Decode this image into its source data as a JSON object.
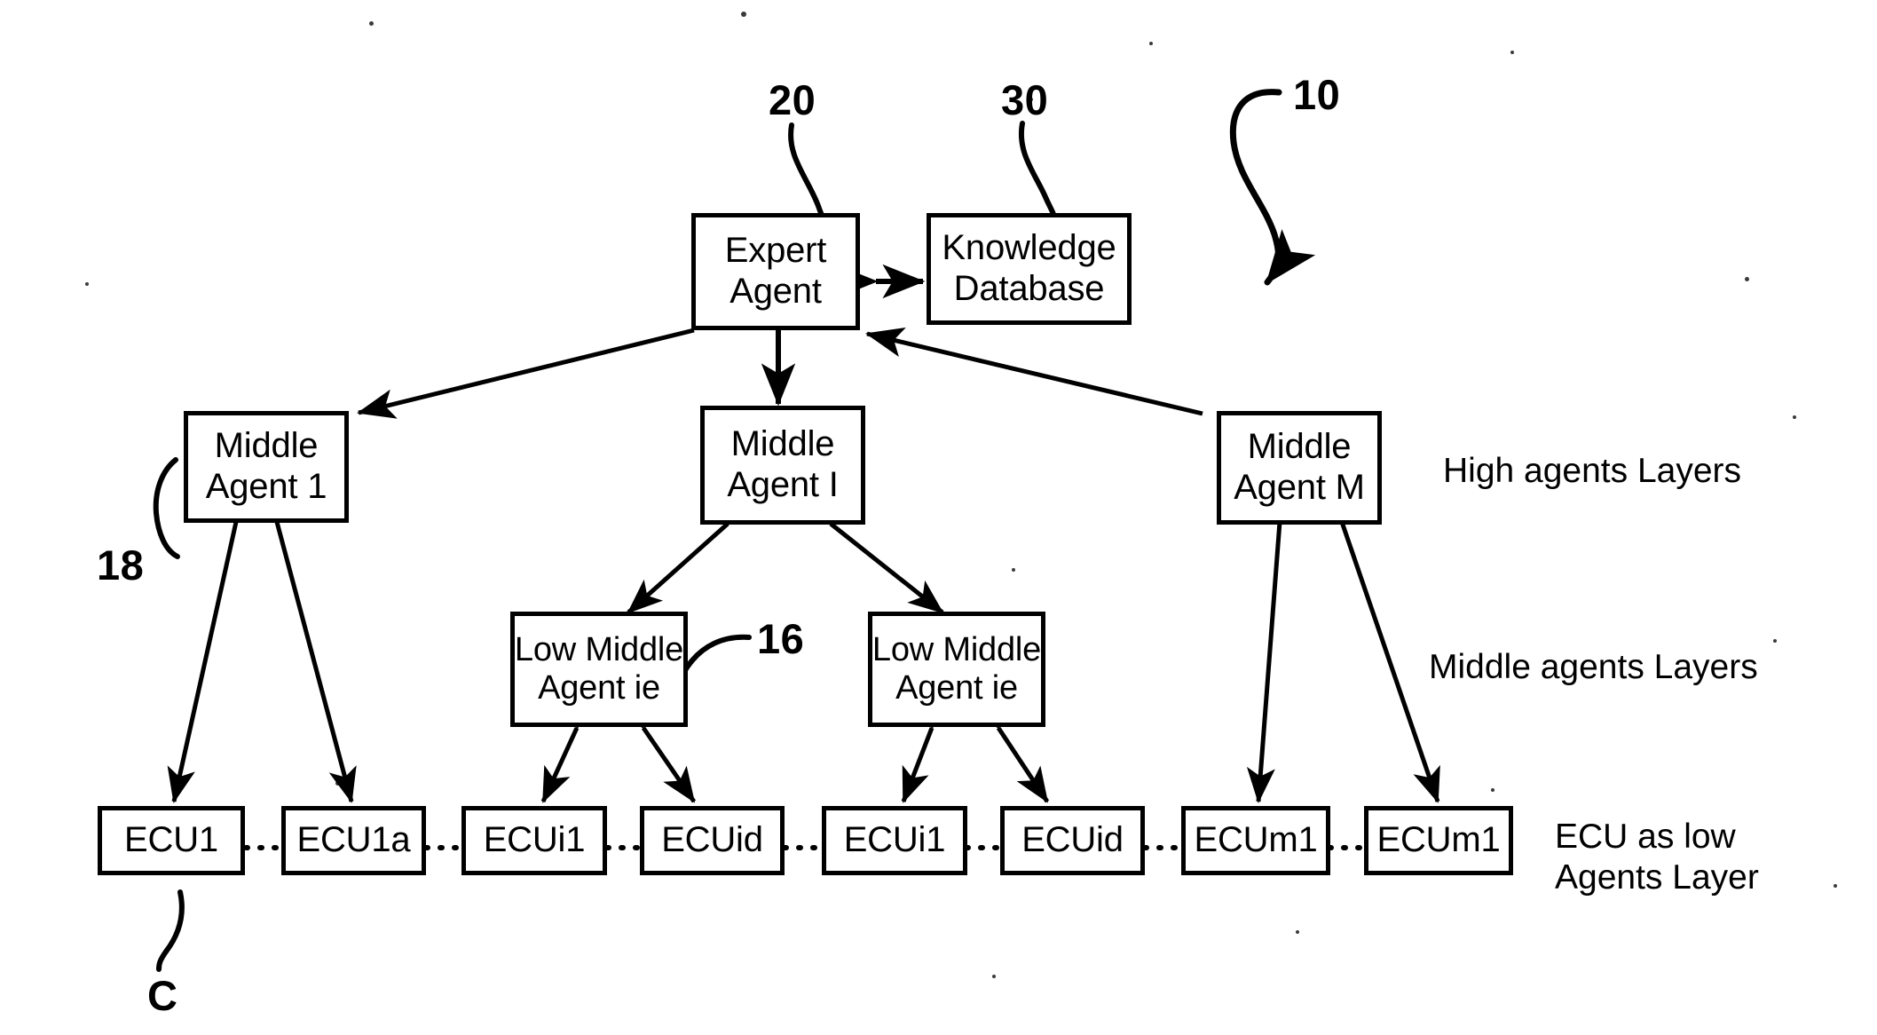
{
  "figure": {
    "title": "Hierarchical agent architecture diagram",
    "background_color": "#ffffff",
    "line_color": "#000000"
  },
  "nodes": {
    "expert_agent": {
      "line1": "Expert",
      "line2": "Agent"
    },
    "knowledge_database": {
      "line1": "Knowledge",
      "line2": "Database"
    },
    "middle_agent_1": {
      "line1": "Middle",
      "line2": "Agent 1"
    },
    "middle_agent_i": {
      "line1": "Middle",
      "line2": "Agent I"
    },
    "middle_agent_m": {
      "line1": "Middle",
      "line2": "Agent M"
    },
    "low_middle_agent_left": {
      "line1": "Low Middle",
      "line2": "Agent ie"
    },
    "low_middle_agent_right": {
      "line1": "Low Middle",
      "line2": "Agent ie"
    },
    "ecu_1": {
      "label": "ECU1"
    },
    "ecu_1a": {
      "label": "ECU1a"
    },
    "ecu_i1_left": {
      "label": "ECUi1"
    },
    "ecu_id_left": {
      "label": "ECUid"
    },
    "ecu_i1_right": {
      "label": "ECUi1"
    },
    "ecu_id_right": {
      "label": "ECUid"
    },
    "ecu_m1_left": {
      "label": "ECUm1"
    },
    "ecu_m1_right": {
      "label": "ECUm1"
    }
  },
  "reference_numerals": {
    "system": "10",
    "expert_agent": "20",
    "knowledge_database": "30",
    "middle_agent": "18",
    "low_middle_agent": "16",
    "ecu_bus": "C"
  },
  "layer_labels": {
    "high": "High agents Layers",
    "middle": "Middle agents Layers",
    "low_line1": "ECU as low",
    "low_line2": "Agents Layer"
  }
}
